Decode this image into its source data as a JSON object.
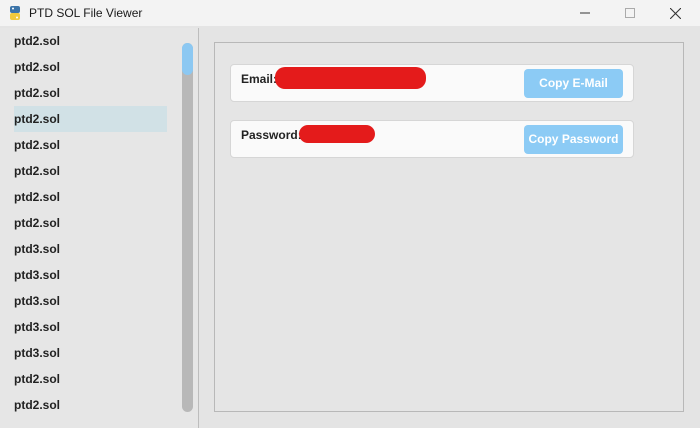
{
  "window": {
    "title": "PTD SOL File Viewer",
    "icon": "python-icon",
    "controls": [
      "minimize",
      "maximize",
      "close"
    ]
  },
  "file_list": {
    "items": [
      "ptd2.sol",
      "ptd2.sol",
      "ptd2.sol",
      "ptd2.sol",
      "ptd2.sol",
      "ptd2.sol",
      "ptd2.sol",
      "ptd2.sol",
      "ptd3.sol",
      "ptd3.sol",
      "ptd3.sol",
      "ptd3.sol",
      "ptd3.sol",
      "ptd2.sol",
      "ptd2.sol"
    ],
    "selected_index": 3
  },
  "details": {
    "email_label": "Email:",
    "password_label": "Password:",
    "copy_email_label": "Copy E-Mail",
    "copy_password_label": "Copy Password"
  },
  "colors": {
    "selection": "#d1e1e6",
    "button": "#8ccbf5",
    "redaction": "#e41b1b"
  }
}
